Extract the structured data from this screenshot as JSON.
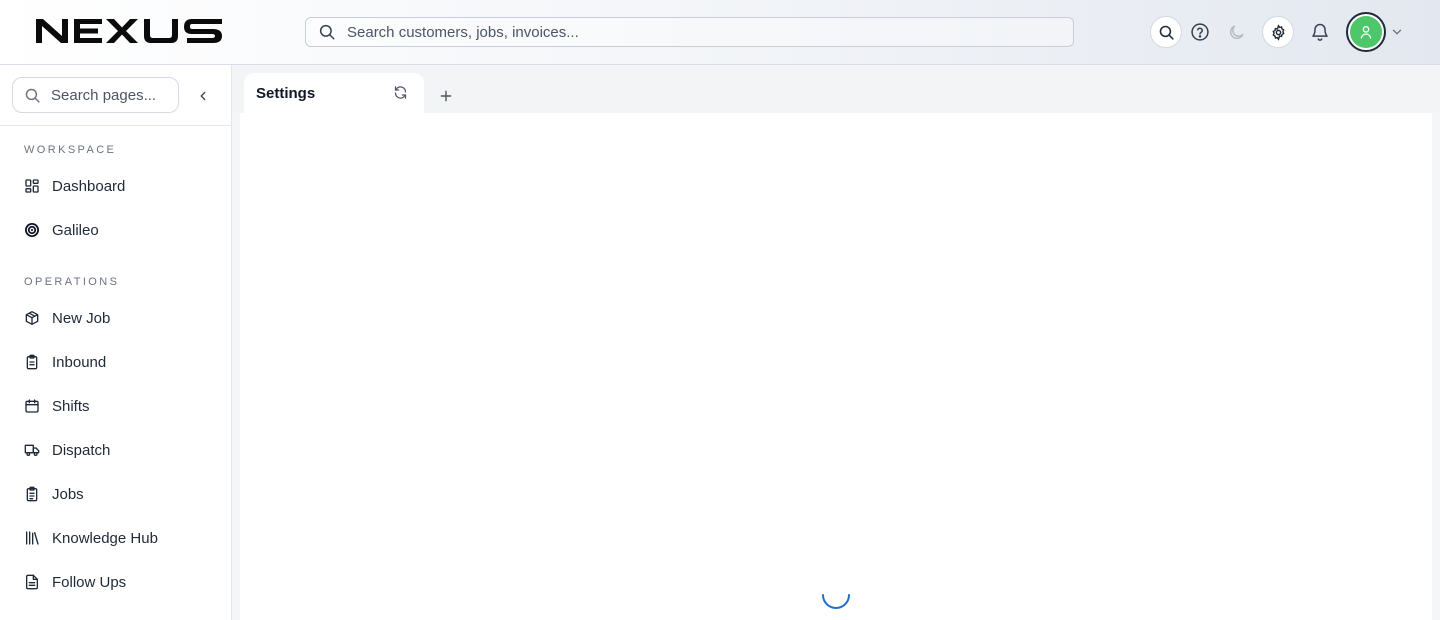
{
  "app": {
    "logo_text": "NEXUS"
  },
  "header": {
    "search_placeholder": "Search customers, jobs, invoices...",
    "icons": [
      "search-icon",
      "help-icon",
      "moon-icon",
      "gear-icon",
      "bell-icon",
      "user-avatar",
      "chevron-down-icon"
    ]
  },
  "sidebar": {
    "search_placeholder": "Search pages...",
    "sections": [
      {
        "label": "WORKSPACE"
      },
      {
        "label": "OPERATIONS"
      }
    ],
    "items": [
      {
        "label": "Dashboard",
        "icon": "grid-icon"
      },
      {
        "label": "Galileo",
        "icon": "galileo-icon"
      },
      {
        "label": "New Job",
        "icon": "box-icon"
      },
      {
        "label": "Inbound",
        "icon": "clipboard-icon"
      },
      {
        "label": "Shifts",
        "icon": "calendar-icon"
      },
      {
        "label": "Dispatch",
        "icon": "truck-icon"
      },
      {
        "label": "Jobs",
        "icon": "clipboard-list-icon"
      },
      {
        "label": "Knowledge Hub",
        "icon": "library-icon"
      },
      {
        "label": "Follow Ups",
        "icon": "file-text-icon"
      }
    ]
  },
  "tabs": [
    {
      "label": "Settings",
      "active": true
    }
  ],
  "colors": {
    "avatar": "#4ec66a",
    "spinner": "#1d6fd1",
    "text": "#1f2937"
  },
  "state": {
    "loading": true
  }
}
